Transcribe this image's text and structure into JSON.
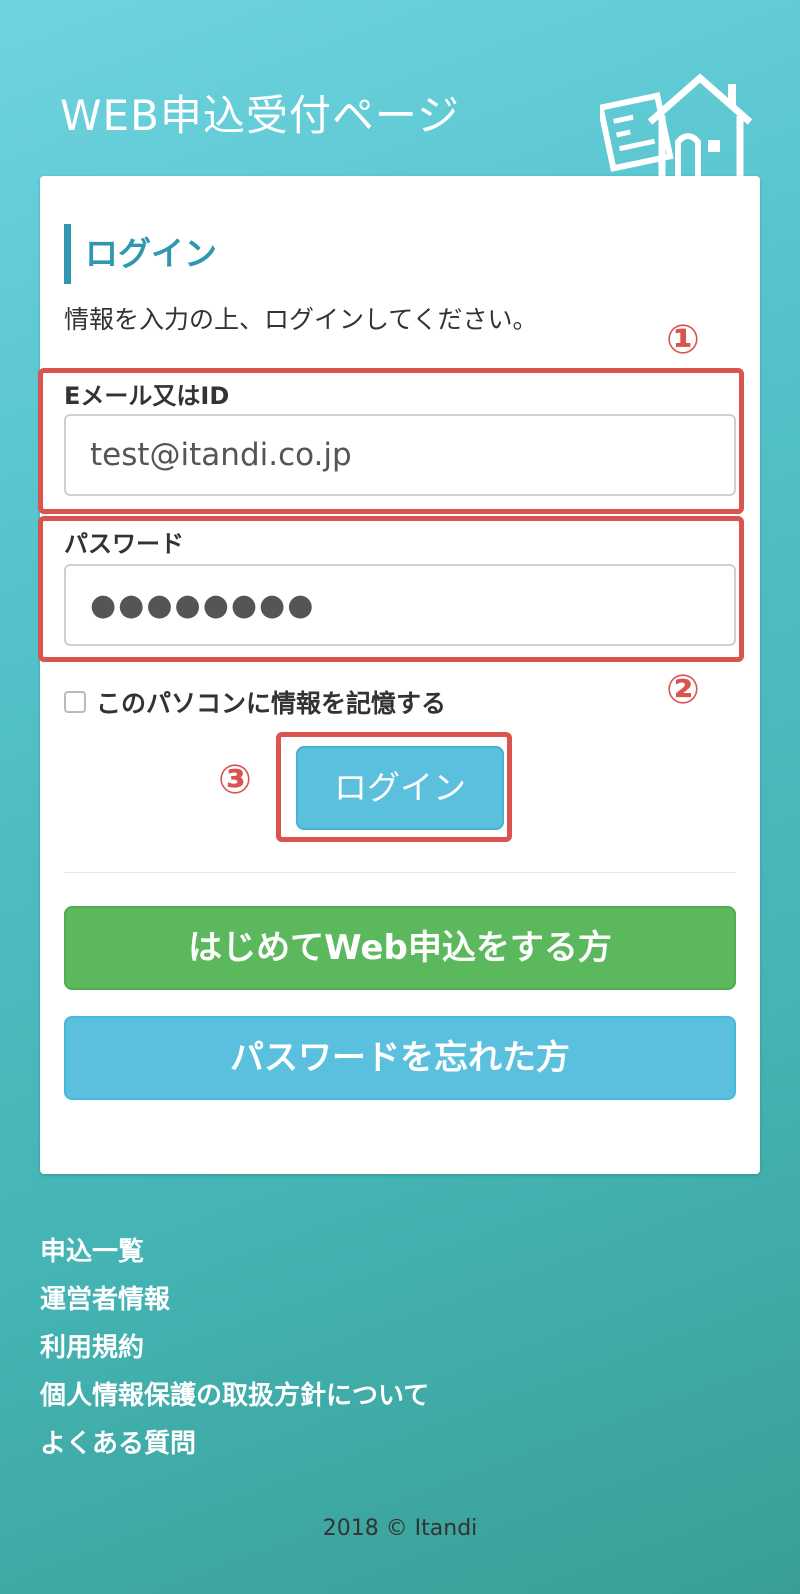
{
  "header": {
    "site_title": "WEB申込受付ページ"
  },
  "login": {
    "heading": "ログイン",
    "instruction": "情報を入力の上、ログインしてください。",
    "email_label": "Eメール又はID",
    "email_value": "test@itandi.co.jp",
    "password_label": "パスワード",
    "password_value": "●●●●●●●●",
    "remember_label": "このパソコンに情報を記憶する",
    "login_button": "ログイン"
  },
  "annotations": {
    "one": "①",
    "two": "②",
    "three": "③"
  },
  "actions": {
    "first_time": "はじめてWeb申込をする方",
    "forgot_password": "パスワードを忘れた方"
  },
  "footer": {
    "links": [
      "申込一覧",
      "運営者情報",
      "利用規約",
      "個人情報保護の取扱方針について",
      "よくある質問"
    ],
    "copyright": "2018 © Itandi"
  },
  "colors": {
    "accent": "#2f97b0",
    "annotation": "#d9534f",
    "button_blue": "#5bc0de",
    "button_green": "#5cb85c"
  }
}
